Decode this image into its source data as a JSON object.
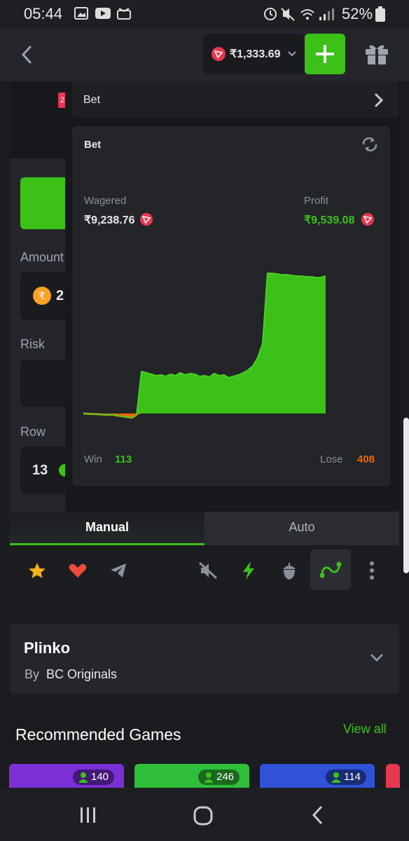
{
  "status_bar": {
    "time": "05:44",
    "battery": "52%"
  },
  "header": {
    "balance": "₹1,333.69",
    "deposit_symbol": "+"
  },
  "game_panel": {
    "amount_label": "Amount",
    "amount_value": "2",
    "risk_label": "Risk",
    "row_label": "Row",
    "row_value": "13",
    "side_badge": "2"
  },
  "bet_dropdown": {
    "label": "Bet",
    "card_title": "Bet",
    "wagered_label": "Wagered",
    "wagered_value": "₹9,238.76",
    "profit_label": "Profit",
    "profit_value": "₹9,539.08",
    "win_label": "Win",
    "win_value": "113",
    "lose_label": "Lose",
    "lose_value": "408"
  },
  "chart_data": {
    "type": "area",
    "title": "",
    "xlabel": "",
    "ylabel": "",
    "x": [
      0,
      2,
      4,
      6,
      8,
      10,
      12,
      14,
      16,
      18,
      20,
      22,
      24,
      26,
      28,
      30,
      32,
      34,
      36,
      38,
      40,
      42,
      44,
      46,
      48,
      50,
      52,
      54,
      56,
      58,
      60,
      62,
      64,
      66,
      68,
      70,
      72,
      74,
      76,
      78,
      80,
      82,
      84,
      86,
      88,
      90,
      92,
      94,
      96,
      98,
      100
    ],
    "series": [
      {
        "values": [
          0,
          -0.5,
          -0.8,
          -1,
          -1.5,
          -2,
          -1.5,
          -3,
          -4,
          -5,
          -6,
          -2,
          60,
          58,
          56,
          54,
          55,
          53,
          56,
          54,
          58,
          55,
          57,
          56,
          53,
          54,
          52,
          57,
          54,
          55,
          51,
          53,
          55,
          58,
          62,
          68,
          80,
          100,
          200,
          200,
          199,
          198,
          198,
          197,
          196,
          196,
          195,
          195,
          194,
          194,
          196
        ]
      }
    ],
    "ylim": [
      -10,
      210
    ],
    "colors": {
      "positive": "#3bc117",
      "negative": "#ed6300"
    },
    "grid": false
  },
  "tabs": {
    "manual": "Manual",
    "auto": "Auto"
  },
  "toolbar": {
    "icons": [
      "star-icon",
      "heart-icon",
      "telegram-icon",
      "sound-off-icon",
      "lightning-icon",
      "acorn-icon",
      "trend-icon",
      "more-icon"
    ]
  },
  "game_info": {
    "title": "Plinko",
    "by_label": "By",
    "provider": "BC Originals"
  },
  "recommended": {
    "title": "Recommended Games",
    "view_all": "View all",
    "games": [
      {
        "players": "140",
        "color": "#7b2fd6"
      },
      {
        "players": "246",
        "color": "#2fbf3a"
      },
      {
        "players": "114",
        "color": "#2f52d6"
      }
    ]
  },
  "colors": {
    "accent": "#3bc117",
    "loss": "#ed6300",
    "tron": "#e8384f"
  }
}
